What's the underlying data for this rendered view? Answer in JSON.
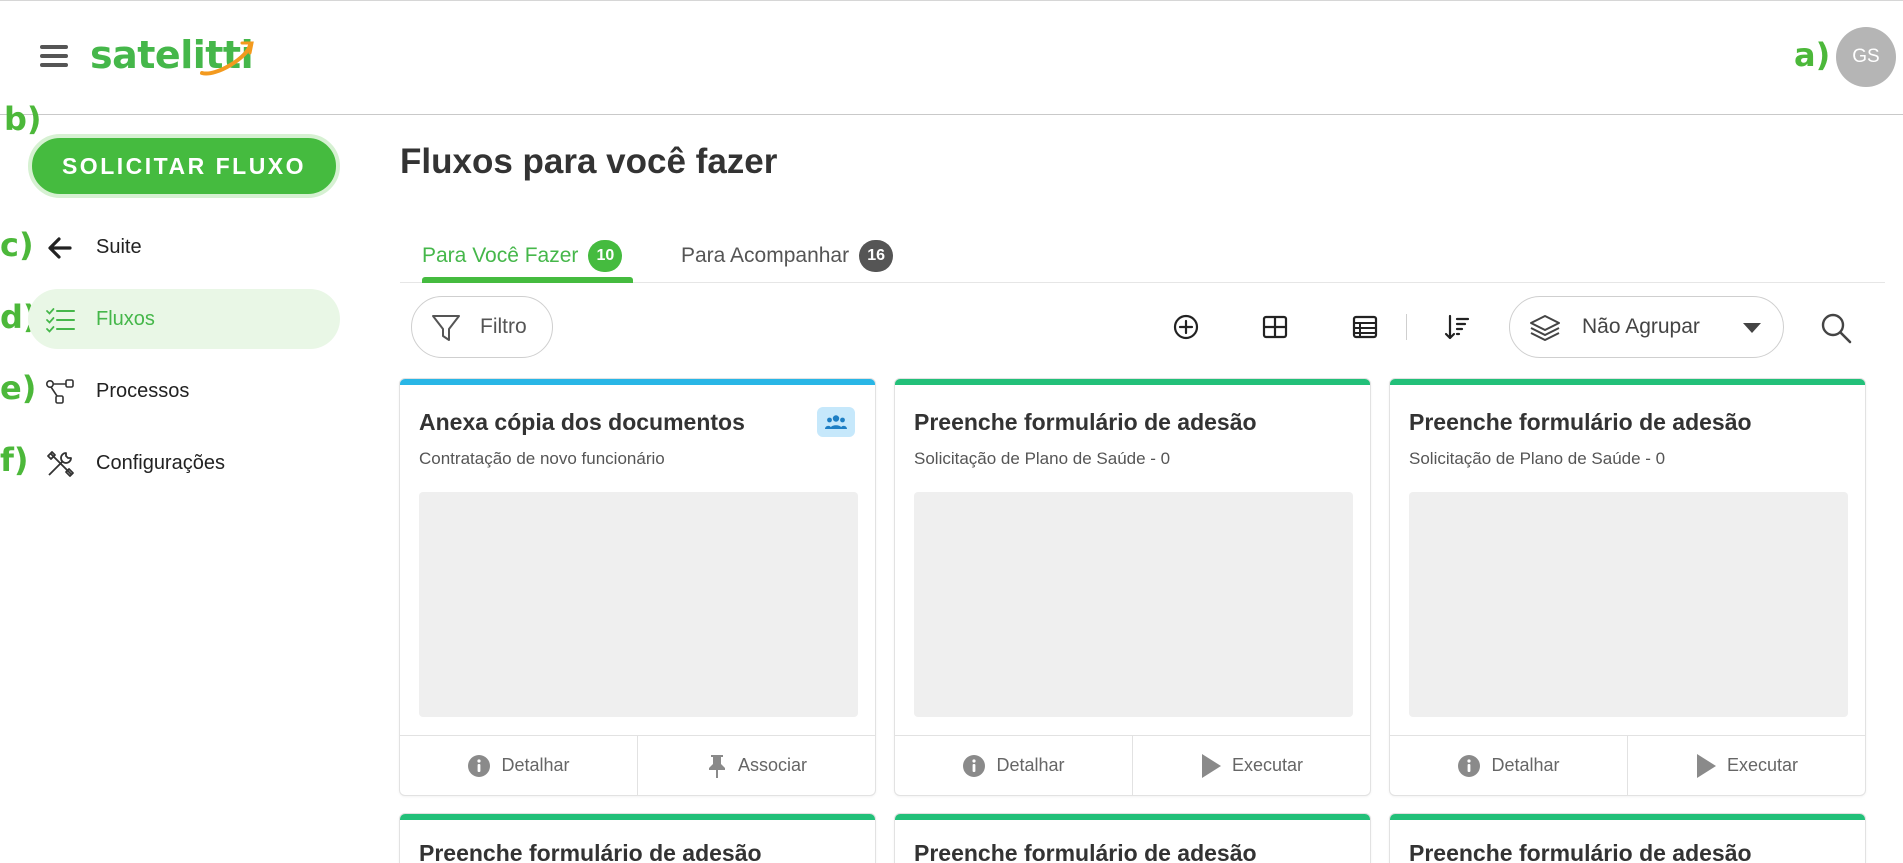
{
  "header": {
    "logo_text": "satelitti",
    "avatar_initials": "GS"
  },
  "annotations": [
    "a)",
    "b)",
    "c)",
    "d)",
    "e)",
    "f)"
  ],
  "sidebar": {
    "primary_button": "SOLICITAR FLUXO",
    "items": [
      {
        "label": "Suite",
        "icon": "arrow-left-icon"
      },
      {
        "label": "Fluxos",
        "icon": "checklist-icon",
        "active": true
      },
      {
        "label": "Processos",
        "icon": "process-nodes-icon"
      },
      {
        "label": "Configurações",
        "icon": "tools-icon"
      }
    ]
  },
  "main": {
    "title": "Fluxos para você fazer",
    "tabs": [
      {
        "label": "Para Você Fazer",
        "badge": "10",
        "active": true
      },
      {
        "label": "Para Acompanhar",
        "badge": "16",
        "active": false
      }
    ],
    "toolbar": {
      "filter_label": "Filtro",
      "group_select_value": "Não Agrupar",
      "icons": [
        "add-circle-icon",
        "grid-view-icon",
        "table-view-icon",
        "sort-icon",
        "layers-icon",
        "search-icon"
      ]
    },
    "cards": [
      {
        "title": "Anexa cópia dos documentos",
        "subtitle": "Contratação de novo funcionário",
        "accent": "#29b6e6",
        "tag_icon": "group-icon",
        "actions": [
          {
            "label": "Detalhar",
            "icon": "info-icon"
          },
          {
            "label": "Associar",
            "icon": "pin-icon"
          }
        ]
      },
      {
        "title": "Preenche formulário de adesão",
        "subtitle": "Solicitação de Plano de Saúde - 0",
        "accent": "#22c079",
        "actions": [
          {
            "label": "Detalhar",
            "icon": "info-icon"
          },
          {
            "label": "Executar",
            "icon": "play-icon"
          }
        ]
      },
      {
        "title": "Preenche formulário de adesão",
        "subtitle": "Solicitação de Plano de Saúde - 0",
        "accent": "#22c079",
        "actions": [
          {
            "label": "Detalhar",
            "icon": "info-icon"
          },
          {
            "label": "Executar",
            "icon": "play-icon"
          }
        ]
      },
      {
        "title": "Preenche formulário de adesão",
        "subtitle": "",
        "accent": "#22c079"
      },
      {
        "title": "Preenche formulário de adesão",
        "subtitle": "",
        "accent": "#22c079"
      },
      {
        "title": "Preenche formulário de adesão",
        "subtitle": "",
        "accent": "#22c079"
      }
    ]
  },
  "colors": {
    "brand_green": "#45bb3f",
    "active_bg": "#e9f7e6",
    "card_blue_accent": "#29b6e6",
    "card_green_accent": "#22c079",
    "logo_orange": "#f39a1f"
  }
}
